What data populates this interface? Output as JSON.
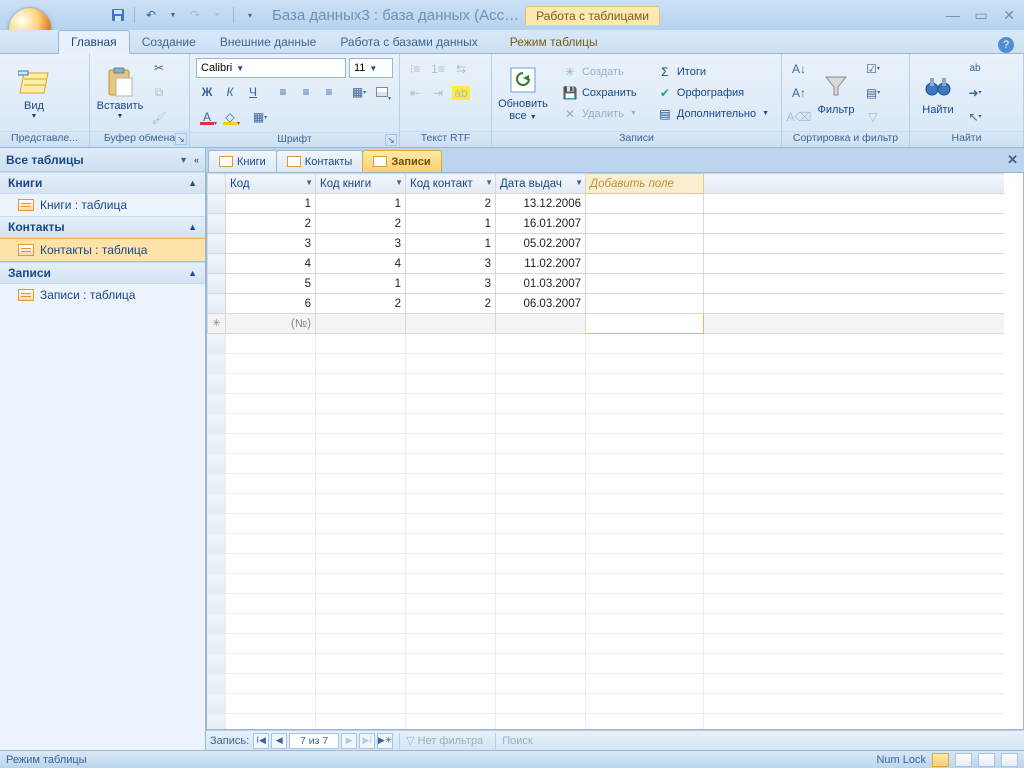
{
  "title": "База данных3 : база данных (Acc…",
  "context_tab": "Работа с таблицами",
  "ribbon_tabs": {
    "home": "Главная",
    "create": "Создание",
    "external": "Внешние данные",
    "dbtools": "Работа с базами данных",
    "datasheet": "Режим таблицы"
  },
  "groups": {
    "view": {
      "btn": "Вид",
      "label": "Представле..."
    },
    "clipboard": {
      "paste": "Вставить",
      "label": "Буфер обмена"
    },
    "font": {
      "name": "Calibri",
      "size": "11",
      "label": "Шрифт"
    },
    "richtext": {
      "label": "Текст RTF"
    },
    "records": {
      "refresh": "Обновить",
      "refresh2": "все",
      "new": "Создать",
      "save": "Сохранить",
      "delete": "Удалить",
      "totals": "Итоги",
      "spelling": "Орфография",
      "more": "Дополнительно",
      "label": "Записи"
    },
    "sortfilter": {
      "filter": "Фильтр",
      "label": "Сортировка и фильтр"
    },
    "find": {
      "find": "Найти",
      "label": "Найти"
    }
  },
  "nav": {
    "header": "Все таблицы",
    "cats": [
      {
        "name": "Книги",
        "items": [
          "Книги : таблица"
        ]
      },
      {
        "name": "Контакты",
        "items": [
          "Контакты : таблица"
        ]
      },
      {
        "name": "Записи",
        "items": [
          "Записи : таблица"
        ]
      }
    ]
  },
  "doc_tabs": [
    "Книги",
    "Контакты",
    "Записи"
  ],
  "active_doc_tab": 2,
  "grid": {
    "columns": [
      "Код",
      "Код книги",
      "Код контакт",
      "Дата выдач"
    ],
    "add_column": "Добавить поле",
    "rows": [
      {
        "c": [
          1,
          1,
          2,
          "13.12.2006"
        ]
      },
      {
        "c": [
          2,
          2,
          1,
          "16.01.2007"
        ]
      },
      {
        "c": [
          3,
          3,
          1,
          "05.02.2007"
        ]
      },
      {
        "c": [
          4,
          4,
          3,
          "11.02.2007"
        ]
      },
      {
        "c": [
          5,
          1,
          3,
          "01.03.2007"
        ]
      },
      {
        "c": [
          6,
          2,
          2,
          "06.03.2007"
        ]
      }
    ],
    "new_placeholder": "(№)"
  },
  "record_nav": {
    "label": "Запись:",
    "pos": "7 из 7",
    "no_filter": "Нет фильтра",
    "search": "Поиск"
  },
  "status": {
    "mode": "Режим таблицы",
    "numlock": "Num Lock"
  }
}
